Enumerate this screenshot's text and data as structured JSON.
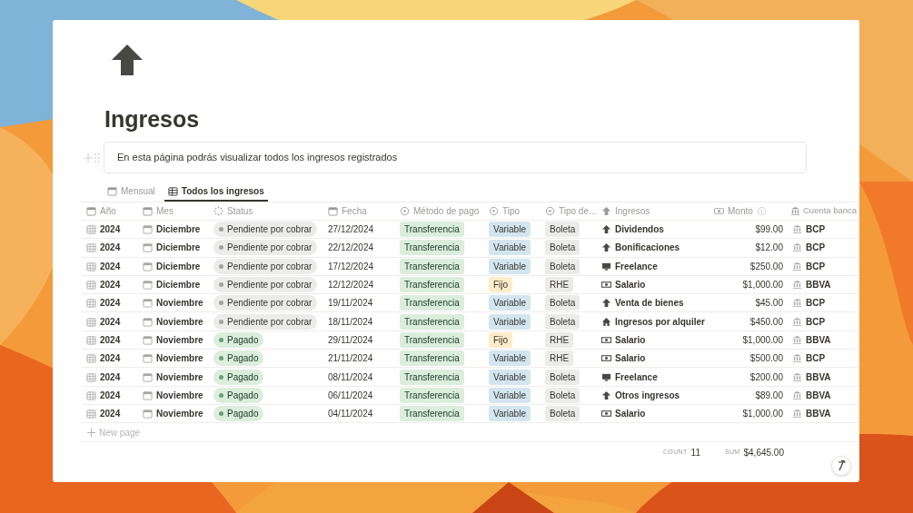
{
  "page": {
    "title": "Ingresos",
    "callout": "En esta página podrás visualizar todos los ingresos registrados"
  },
  "tabs": [
    {
      "label": "Mensual",
      "kind": "calendar",
      "selected": false
    },
    {
      "label": "Todos los ingresos",
      "kind": "table",
      "selected": true
    }
  ],
  "table": {
    "columns": [
      {
        "label": "Año",
        "kind": "calendar"
      },
      {
        "label": "Mes",
        "kind": "calendar"
      },
      {
        "label": "Status",
        "kind": "status"
      },
      {
        "label": "Fecha",
        "kind": "calendar"
      },
      {
        "label": "Método de pago",
        "kind": "select"
      },
      {
        "label": "Tipo",
        "kind": "select"
      },
      {
        "label": "Tipo de...",
        "kind": "select"
      },
      {
        "label": "Ingresos",
        "kind": "arrow"
      },
      {
        "label": "Monto",
        "kind": "money"
      },
      {
        "label": "Cuenta banca",
        "kind": "bank"
      }
    ],
    "rows": [
      {
        "year": "2024",
        "month": "Diciembre",
        "status": {
          "label": "Pendiente por cobrar",
          "kind": "pending"
        },
        "date": "27/12/2024",
        "method": "Transferencia",
        "type": {
          "label": "Variable",
          "color": "#d3e5ef"
        },
        "doc": "Boleta",
        "income": {
          "label": "Dividendos",
          "kind": "arrow"
        },
        "amount": "$99.00",
        "bank": "BCP"
      },
      {
        "year": "2024",
        "month": "Diciembre",
        "status": {
          "label": "Pendiente por cobrar",
          "kind": "pending"
        },
        "date": "22/12/2024",
        "method": "Transferencia",
        "type": {
          "label": "Variable",
          "color": "#d3e5ef"
        },
        "doc": "Boleta",
        "income": {
          "label": "Bonificaciones",
          "kind": "arrow"
        },
        "amount": "$12.00",
        "bank": "BCP"
      },
      {
        "year": "2024",
        "month": "Diciembre",
        "status": {
          "label": "Pendiente por cobrar",
          "kind": "pending"
        },
        "date": "17/12/2024",
        "method": "Transferencia",
        "type": {
          "label": "Variable",
          "color": "#d3e5ef"
        },
        "doc": "Boleta",
        "income": {
          "label": "Freelance",
          "kind": "monitor"
        },
        "amount": "$250.00",
        "bank": "BCP"
      },
      {
        "year": "2024",
        "month": "Diciembre",
        "status": {
          "label": "Pendiente por cobrar",
          "kind": "pending"
        },
        "date": "12/12/2024",
        "method": "Transferencia",
        "type": {
          "label": "Fijo",
          "color": "#fdecc8"
        },
        "doc": "RHE",
        "income": {
          "label": "Salario",
          "kind": "cash"
        },
        "amount": "$1,000.00",
        "bank": "BBVA"
      },
      {
        "year": "2024",
        "month": "Noviembre",
        "status": {
          "label": "Pendiente por cobrar",
          "kind": "pending"
        },
        "date": "19/11/2024",
        "method": "Transferencia",
        "type": {
          "label": "Variable",
          "color": "#d3e5ef"
        },
        "doc": "Boleta",
        "income": {
          "label": "Venta de bienes",
          "kind": "arrow"
        },
        "amount": "$45.00",
        "bank": "BCP"
      },
      {
        "year": "2024",
        "month": "Noviembre",
        "status": {
          "label": "Pendiente por cobrar",
          "kind": "pending"
        },
        "date": "18/11/2024",
        "method": "Transferencia",
        "type": {
          "label": "Variable",
          "color": "#d3e5ef"
        },
        "doc": "Boleta",
        "income": {
          "label": "Ingresos por alquiler",
          "kind": "house"
        },
        "amount": "$450.00",
        "bank": "BCP"
      },
      {
        "year": "2024",
        "month": "Noviembre",
        "status": {
          "label": "Pagado",
          "kind": "paid"
        },
        "date": "29/11/2024",
        "method": "Transferencia",
        "type": {
          "label": "Fijo",
          "color": "#fdecc8"
        },
        "doc": "RHE",
        "income": {
          "label": "Salario",
          "kind": "cash"
        },
        "amount": "$1,000.00",
        "bank": "BBVA"
      },
      {
        "year": "2024",
        "month": "Noviembre",
        "status": {
          "label": "Pagado",
          "kind": "paid"
        },
        "date": "21/11/2024",
        "method": "Transferencia",
        "type": {
          "label": "Variable",
          "color": "#d3e5ef"
        },
        "doc": "RHE",
        "income": {
          "label": "Salario",
          "kind": "cash"
        },
        "amount": "$500.00",
        "bank": "BCP"
      },
      {
        "year": "2024",
        "month": "Noviembre",
        "status": {
          "label": "Pagado",
          "kind": "paid"
        },
        "date": "08/11/2024",
        "method": "Transferencia",
        "type": {
          "label": "Variable",
          "color": "#d3e5ef"
        },
        "doc": "Boleta",
        "income": {
          "label": "Freelance",
          "kind": "monitor"
        },
        "amount": "$200.00",
        "bank": "BBVA"
      },
      {
        "year": "2024",
        "month": "Noviembre",
        "status": {
          "label": "Pagado",
          "kind": "paid"
        },
        "date": "06/11/2024",
        "method": "Transferencia",
        "type": {
          "label": "Variable",
          "color": "#d3e5ef"
        },
        "doc": "Boleta",
        "income": {
          "label": "Otros ingresos",
          "kind": "arrow"
        },
        "amount": "$89.00",
        "bank": "BBVA"
      },
      {
        "year": "2024",
        "month": "Noviembre",
        "status": {
          "label": "Pagado",
          "kind": "paid"
        },
        "date": "04/11/2024",
        "method": "Transferencia",
        "type": {
          "label": "Variable",
          "color": "#d3e5ef"
        },
        "doc": "Boleta",
        "income": {
          "label": "Salario",
          "kind": "cash"
        },
        "amount": "$1,000.00",
        "bank": "BBVA"
      }
    ],
    "new_row": "New page",
    "footer": {
      "count_label": "COUNT",
      "count": "11",
      "sum_label": "SUM",
      "sum": "$4,645.00"
    }
  }
}
